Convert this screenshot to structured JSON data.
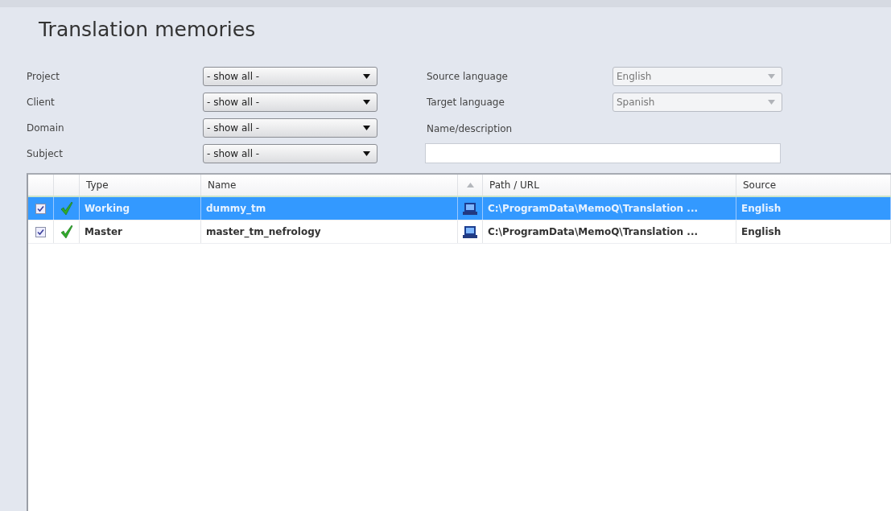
{
  "title": "Translation memories",
  "filters": [
    {
      "label": "Project",
      "value": "- show all -",
      "disabled": false
    },
    {
      "label": "Client",
      "value": "- show all -",
      "disabled": false
    },
    {
      "label": "Domain",
      "value": "- show all -",
      "disabled": false
    },
    {
      "label": "Subject",
      "value": "- show all -",
      "disabled": false
    }
  ],
  "languages": [
    {
      "label": "Source language",
      "value": "English",
      "disabled": true
    },
    {
      "label": "Target language",
      "value": "Spanish",
      "disabled": true
    }
  ],
  "name_filter": {
    "label": "Name/description"
  },
  "table": {
    "columns": [
      "Type",
      "Name",
      "Path / URL",
      "Source"
    ],
    "rows": [
      {
        "checked": true,
        "selected": true,
        "type": "Working",
        "name": "dummy_tm",
        "path": "C:\\ProgramData\\MemoQ\\Translation ...",
        "source": "English"
      },
      {
        "checked": true,
        "selected": false,
        "type": "Master",
        "name": "master_tm_nefrology",
        "path": "C:\\ProgramData\\MemoQ\\Translation ...",
        "source": "English"
      }
    ]
  }
}
